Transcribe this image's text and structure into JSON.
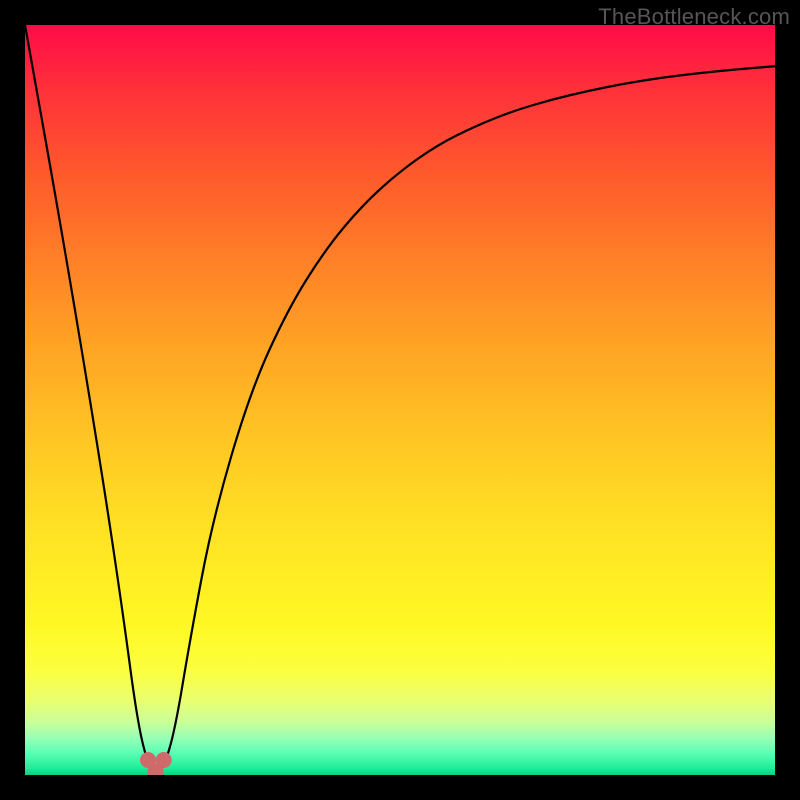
{
  "watermark": "TheBottleneck.com",
  "chart_data": {
    "type": "line",
    "title": "",
    "xlabel": "",
    "ylabel": "",
    "xlim": [
      0,
      100
    ],
    "ylim": [
      0,
      100
    ],
    "curve": {
      "x": [
        0,
        5,
        10,
        13,
        15,
        16.5,
        17.5,
        18.5,
        20,
        22,
        25,
        30,
        35,
        40,
        45,
        50,
        55,
        60,
        65,
        70,
        75,
        80,
        85,
        90,
        95,
        100
      ],
      "y": [
        100,
        72,
        42,
        22,
        7,
        1,
        0.3,
        1,
        6,
        18,
        34,
        51,
        62,
        70,
        76,
        80.5,
        84,
        86.5,
        88.5,
        90,
        91.2,
        92.2,
        93,
        93.6,
        94.1,
        94.5
      ]
    },
    "markers": {
      "x": [
        16.4,
        17.4,
        18.5
      ],
      "y": [
        2.0,
        0.5,
        2.0
      ],
      "color": "#d06a6a",
      "radius_px": 8
    },
    "background_gradient": {
      "stops": [
        {
          "pct": 0,
          "color": "#ff0b48"
        },
        {
          "pct": 20,
          "color": "#ff5a2c"
        },
        {
          "pct": 50,
          "color": "#ffc823"
        },
        {
          "pct": 80,
          "color": "#fff824"
        },
        {
          "pct": 95,
          "color": "#99ffb5"
        },
        {
          "pct": 100,
          "color": "#08d282"
        }
      ]
    }
  },
  "colors": {
    "curve_stroke": "#000000",
    "marker_fill": "#d06a6a",
    "frame": "#000000",
    "watermark": "#565656"
  }
}
